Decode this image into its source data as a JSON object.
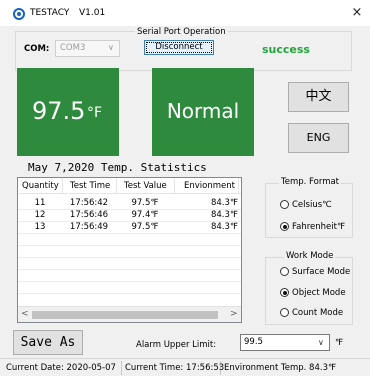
{
  "window": {
    "title": "TESTACY",
    "version": "V1.01",
    "close_glyph": "×"
  },
  "serial_port": {
    "legend": "Serial Port Operation",
    "com_label": "COM:",
    "com_value": "COM3",
    "disconnect_label": "Disconnect",
    "status_text": "success",
    "status_color": "#22a53b"
  },
  "display": {
    "temperature": "97.5",
    "unit": "°F",
    "status": "Normal",
    "panel_color": "#2e8b3e"
  },
  "language": {
    "chinese_label": "中文",
    "english_label": "ENG"
  },
  "stats": {
    "title": "May 7,2020 Temp. Statistics",
    "columns": [
      "Quantity",
      "Test Time",
      "Test Value",
      "Envionment"
    ],
    "rows": [
      [
        "11",
        "17:56:42",
        "97.5℉",
        "84.3℉"
      ],
      [
        "12",
        "17:56:46",
        "97.4℉",
        "84.3℉"
      ],
      [
        "13",
        "17:56:49",
        "97.5℉",
        "84.3℉"
      ]
    ],
    "scroll_left": "<",
    "scroll_right": ">"
  },
  "temp_format": {
    "legend": "Temp. Format",
    "options": [
      "Celsius℃",
      "Fahrenheit℉"
    ],
    "selected": "Fahrenheit℉"
  },
  "work_mode": {
    "legend": "Work Mode",
    "options": [
      "Surface Mode",
      "Object Mode",
      "Count Mode"
    ],
    "selected": "Object Mode"
  },
  "bottom": {
    "save_label": "Save As",
    "alarm_label": "Alarm Upper Limit:",
    "alarm_value": "99.5",
    "alarm_unit": "℉"
  },
  "statusbar": {
    "date_label": "Current Date:",
    "date_value": "2020-05-07",
    "time_label": "Current Time:",
    "time_value": "17:56:53",
    "env_label": "Environment Temp.",
    "env_value": "84.3℉"
  }
}
